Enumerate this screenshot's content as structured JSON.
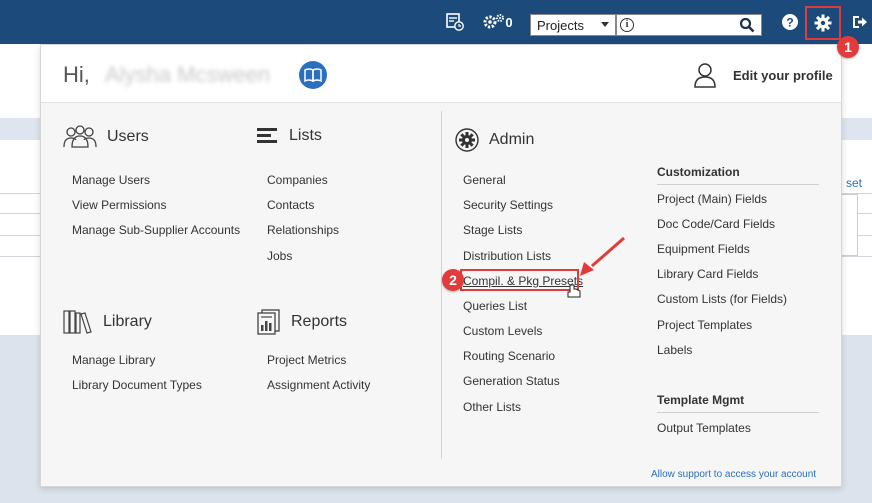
{
  "topbar": {
    "task_count": "0",
    "scope_select": "Projects",
    "search_placeholder": ""
  },
  "background": {
    "partial_link": "set"
  },
  "header": {
    "greeting": "Hi,",
    "user_name": "Alysha Mcsween",
    "edit_profile": "Edit your profile"
  },
  "users": {
    "title": "Users",
    "items": [
      "Manage Users",
      "View Permissions",
      "Manage Sub-Supplier Accounts"
    ]
  },
  "lists": {
    "title": "Lists",
    "items": [
      "Companies",
      "Contacts",
      "Relationships",
      "Jobs"
    ]
  },
  "library": {
    "title": "Library",
    "items": [
      "Manage Library",
      "Library Document Types"
    ]
  },
  "reports": {
    "title": "Reports",
    "items": [
      "Project Metrics",
      "Assignment Activity"
    ]
  },
  "admin": {
    "title": "Admin",
    "items": [
      "General",
      "Security Settings",
      "Stage Lists",
      "Distribution Lists",
      "Compil. & Pkg Presets",
      "Queries List",
      "Custom Levels",
      "Routing Scenario",
      "Generation Status",
      "Other Lists"
    ]
  },
  "customization": {
    "title": "Customization",
    "items": [
      "Project (Main) Fields",
      "Doc Code/Card Fields",
      "Equipment Fields",
      "Library Card Fields",
      "Custom Lists (for Fields)",
      "Project Templates",
      "Labels"
    ]
  },
  "template_mgmt": {
    "title": "Template Mgmt",
    "items": [
      "Output Templates"
    ]
  },
  "support_link": "Allow support to access your account",
  "annotations": {
    "badge1": "1",
    "badge2": "2"
  },
  "colors": {
    "topbar": "#1c4a7a",
    "accent": "#2a6fc0",
    "annotation": "#e23b3b"
  }
}
